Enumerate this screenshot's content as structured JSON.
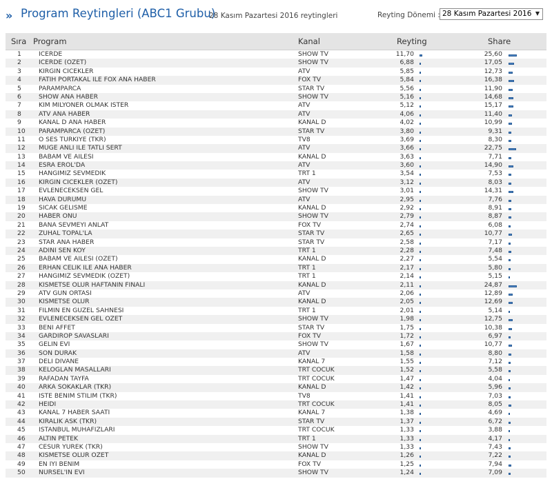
{
  "header": {
    "arrows": "»",
    "title": "Program Reytingleri (ABC1 Grubu)",
    "subtitle": "28 Kasım Pazartesi 2016 reytingleri",
    "period_label": "Reyting Dönemi :",
    "period_value": "28 Kasım Pazartesi 2016",
    "period_arrow": "▼"
  },
  "table": {
    "headers": {
      "rank": "Sıra",
      "program": "Program",
      "channel": "Kanal",
      "rating": "Reyting",
      "share": "Share"
    }
  },
  "chart_data": {
    "type": "table",
    "columns": [
      "Sıra",
      "Program",
      "Kanal",
      "Reyting",
      "Share"
    ],
    "rows": [
      [
        "1",
        "ICERDE",
        "SHOW TV",
        "11,70",
        "25,60"
      ],
      [
        "2",
        "ICERDE (OZET)",
        "SHOW TV",
        "6,88",
        "17,05"
      ],
      [
        "3",
        "KIRGIN CICEKLER",
        "ATV",
        "5,85",
        "12,73"
      ],
      [
        "4",
        "FATIH PORTAKAL ILE FOX ANA HABER",
        "FOX TV",
        "5,84",
        "16,38"
      ],
      [
        "5",
        "PARAMPARCA",
        "STAR TV",
        "5,56",
        "11,90"
      ],
      [
        "6",
        "SHOW ANA HABER",
        "SHOW TV",
        "5,16",
        "14,68"
      ],
      [
        "7",
        "KIM MILYONER OLMAK ISTER",
        "ATV",
        "5,12",
        "15,17"
      ],
      [
        "8",
        "ATV ANA HABER",
        "ATV",
        "4,06",
        "11,40"
      ],
      [
        "9",
        "KANAL D ANA HABER",
        "KANAL D",
        "4,02",
        "10,99"
      ],
      [
        "10",
        "PARAMPARCA (OZET)",
        "STAR TV",
        "3,80",
        "9,31"
      ],
      [
        "11",
        "O SES TURKIYE (TKR)",
        "TV8",
        "3,69",
        "8,30"
      ],
      [
        "12",
        "MUGE ANLI ILE TATLI SERT",
        "ATV",
        "3,66",
        "22,75"
      ],
      [
        "13",
        "BABAM VE AILESI",
        "KANAL D",
        "3,63",
        "7,71"
      ],
      [
        "14",
        "ESRA EROL'DA",
        "ATV",
        "3,60",
        "14,90"
      ],
      [
        "15",
        "HANGIMIZ SEVMEDIK",
        "TRT 1",
        "3,54",
        "7,53"
      ],
      [
        "16",
        "KIRGIN CICEKLER (OZET)",
        "ATV",
        "3,12",
        "8,03"
      ],
      [
        "17",
        "EVLENECEKSEN GEL",
        "SHOW TV",
        "3,01",
        "14,31"
      ],
      [
        "18",
        "HAVA DURUMU",
        "ATV",
        "2,95",
        "7,76"
      ],
      [
        "19",
        "SICAK GELISME",
        "KANAL D",
        "2,92",
        "8,91"
      ],
      [
        "20",
        "HABER ONU",
        "SHOW TV",
        "2,79",
        "8,87"
      ],
      [
        "21",
        "BANA SEVMEYI ANLAT",
        "FOX TV",
        "2,74",
        "6,08"
      ],
      [
        "22",
        "ZUHAL TOPAL'LA",
        "STAR TV",
        "2,65",
        "10,77"
      ],
      [
        "23",
        "STAR ANA HABER",
        "STAR TV",
        "2,58",
        "7,17"
      ],
      [
        "24",
        "ADINI SEN KOY",
        "TRT 1",
        "2,28",
        "7,48"
      ],
      [
        "25",
        "BABAM VE AILESI (OZET)",
        "KANAL D",
        "2,27",
        "5,54"
      ],
      [
        "26",
        "ERHAN CELIK ILE ANA HABER",
        "TRT 1",
        "2,17",
        "5,80"
      ],
      [
        "27",
        "HANGIMIZ SEVMEDIK (OZET)",
        "TRT 1",
        "2,14",
        "5,15"
      ],
      [
        "28",
        "KISMETSE OLUR HAFTANIN FINALI",
        "KANAL D",
        "2,11",
        "24,87"
      ],
      [
        "29",
        "ATV GUN ORTASI",
        "ATV",
        "2,06",
        "12,89"
      ],
      [
        "30",
        "KISMETSE OLUR",
        "KANAL D",
        "2,05",
        "12,69"
      ],
      [
        "31",
        "FILMIN EN GUZEL SAHNESI",
        "TRT 1",
        "2,01",
        "5,14"
      ],
      [
        "32",
        "EVLENECEKSEN GEL OZET",
        "SHOW TV",
        "1,98",
        "12,75"
      ],
      [
        "33",
        "BENI AFFET",
        "STAR TV",
        "1,75",
        "10,38"
      ],
      [
        "34",
        "GARDIROP SAVASLARI",
        "FOX TV",
        "1,72",
        "6,97"
      ],
      [
        "35",
        "GELIN EVI",
        "SHOW TV",
        "1,67",
        "10,77"
      ],
      [
        "36",
        "SON DURAK",
        "ATV",
        "1,58",
        "8,80"
      ],
      [
        "37",
        "DELI DIVANE",
        "KANAL 7",
        "1,55",
        "7,12"
      ],
      [
        "38",
        "KELOGLAN MASALLARI",
        "TRT COCUK",
        "1,52",
        "5,58"
      ],
      [
        "39",
        "RAFADAN TAYFA",
        "TRT COCUK",
        "1,47",
        "4,04"
      ],
      [
        "40",
        "ARKA SOKAKLAR (TKR)",
        "KANAL D",
        "1,42",
        "5,96"
      ],
      [
        "41",
        "ISTE BENIM STILIM (TKR)",
        "TV8",
        "1,41",
        "7,03"
      ],
      [
        "42",
        "HEIDI",
        "TRT COCUK",
        "1,41",
        "8,05"
      ],
      [
        "43",
        "KANAL 7 HABER SAATI",
        "KANAL 7",
        "1,38",
        "4,69"
      ],
      [
        "44",
        "KIRALIK ASK (TKR)",
        "STAR TV",
        "1,37",
        "6,72"
      ],
      [
        "45",
        "ISTANBUL MUHAFIZLARI",
        "TRT COCUK",
        "1,33",
        "3,88"
      ],
      [
        "46",
        "ALTIN PETEK",
        "TRT 1",
        "1,33",
        "4,17"
      ],
      [
        "47",
        "CESUR YUREK (TKR)",
        "SHOW TV",
        "1,33",
        "7,43"
      ],
      [
        "48",
        "KISMETSE OLUR OZET",
        "KANAL D",
        "1,26",
        "7,22"
      ],
      [
        "49",
        "EN IYI BENIM",
        "FOX TV",
        "1,25",
        "7,94"
      ],
      [
        "50",
        "NURSEL'IN EVI",
        "SHOW TV",
        "1,24",
        "7,09"
      ]
    ]
  }
}
